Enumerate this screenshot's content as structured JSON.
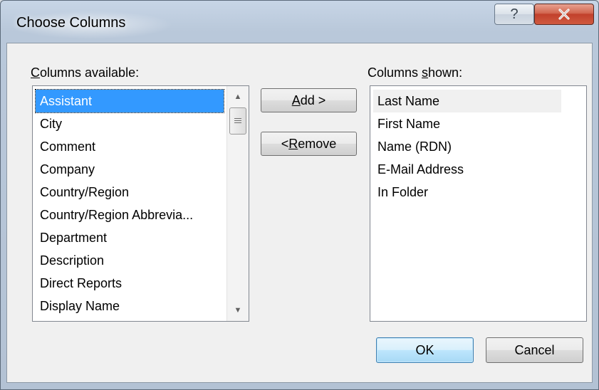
{
  "window": {
    "title": "Choose Columns",
    "help_glyph": "?",
    "close_glyph": "✕"
  },
  "available": {
    "label_accel": "C",
    "label_rest": "olumns available:",
    "items": [
      "Assistant",
      "City",
      "Comment",
      "Company",
      "Country/Region",
      "Country/Region Abbrevia...",
      "Department",
      "Description",
      "Direct Reports",
      "Display Name"
    ],
    "selected_index": 0
  },
  "shown": {
    "label_pre": "Columns ",
    "label_accel": "s",
    "label_rest": "hown:",
    "items": [
      "Last Name",
      "First Name",
      "Name (RDN)",
      "E-Mail Address",
      "In Folder"
    ]
  },
  "buttons": {
    "add_accel": "A",
    "add_rest": "dd >",
    "remove_pre": "< ",
    "remove_accel": "R",
    "remove_rest": "emove",
    "ok": "OK",
    "cancel": "Cancel"
  },
  "icons": {
    "scroll_up": "▲",
    "scroll_down": "▼"
  }
}
